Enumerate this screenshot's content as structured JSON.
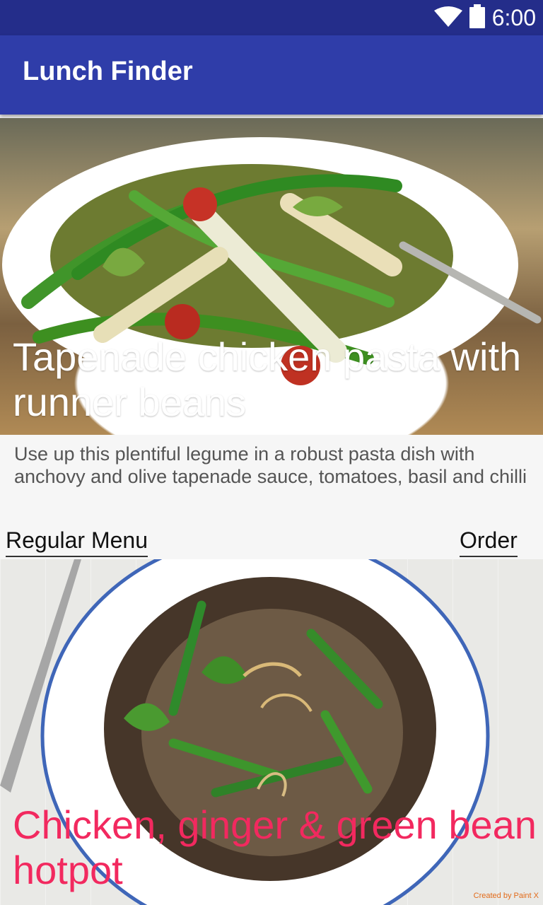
{
  "status_bar": {
    "time": "6:00",
    "icons": [
      "wifi-icon",
      "battery-icon"
    ]
  },
  "app_bar": {
    "title": "Lunch Finder"
  },
  "cards": [
    {
      "title": "Tapenade chicken pasta with runner beans",
      "description": "Use up this plentiful legume in a robust pasta dish with anchovy and olive tapenade sauce, tomatoes, basil and chilli",
      "actions": {
        "regular_menu": "Regular Menu",
        "order": "Order"
      }
    },
    {
      "title": "Chicken, ginger & green bean hotpot"
    }
  ],
  "watermark": "Created by Paint X",
  "colors": {
    "status_bar": "#242d8a",
    "app_bar": "#2f3da9",
    "card_title_highlight": "#f2295f",
    "watermark": "#e26b1a"
  }
}
